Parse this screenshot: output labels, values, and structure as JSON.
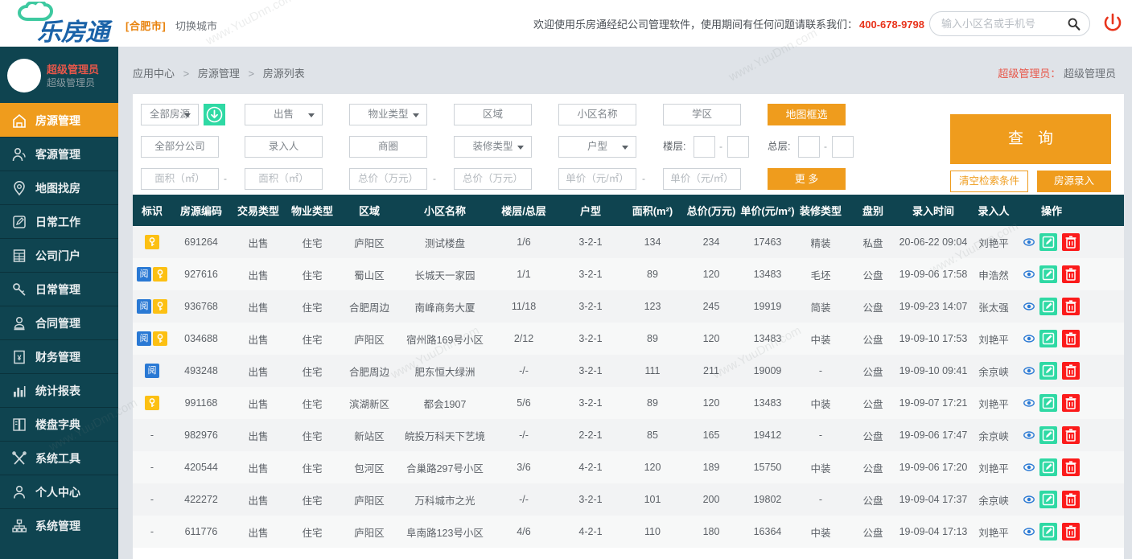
{
  "header": {
    "logo_text": "乐房通",
    "city_tag": "[合肥市]",
    "city_switch": "切换城市",
    "welcome": "欢迎使用乐房通经纪公司管理软件，使用期间有任何问题请联系我们：",
    "tel": "400-678-9798",
    "search_placeholder": "输入小区名或手机号",
    "search_value": "",
    "search_icon": "search-icon",
    "power_icon": "power-icon",
    "accent_orange": "#ef9c1d",
    "accent_red": "#e8341c"
  },
  "sidebar": {
    "user_name": "超级管理员",
    "user_role": "超级管理员",
    "bg_color": "#0f4450",
    "active_color": "#ef9c1d",
    "items": [
      {
        "label": "房源管理",
        "icon": "house-icon",
        "active": true
      },
      {
        "label": "客源管理",
        "icon": "users-icon",
        "active": false
      },
      {
        "label": "地图找房",
        "icon": "map-pin-icon",
        "active": false
      },
      {
        "label": "日常工作",
        "icon": "edit-box-icon",
        "active": false
      },
      {
        "label": "公司门户",
        "icon": "building-icon",
        "active": false
      },
      {
        "label": "日常管理",
        "icon": "key-icon",
        "active": false
      },
      {
        "label": "合同管理",
        "icon": "stamp-icon",
        "active": false
      },
      {
        "label": "财务管理",
        "icon": "yuan-icon",
        "active": false
      },
      {
        "label": "统计报表",
        "icon": "bar-chart-icon",
        "active": false
      },
      {
        "label": "楼盘字典",
        "icon": "book-icon",
        "active": false
      },
      {
        "label": "系统工具",
        "icon": "tools-icon",
        "active": false
      },
      {
        "label": "个人中心",
        "icon": "person-icon",
        "active": false
      },
      {
        "label": "系统管理",
        "icon": "sitemap-icon",
        "active": false
      }
    ]
  },
  "breadcrumb": {
    "items": [
      "应用中心",
      "房源管理",
      "房源列表"
    ],
    "separator": ">"
  },
  "topright_user": {
    "label": "超级管理员：",
    "value": "超级管理员"
  },
  "filters": {
    "source_select": "全部房源",
    "download_icon": "cloud-download-icon",
    "trade_type": "出售",
    "property_type": "物业类型",
    "region": "区域",
    "community": "小区名称",
    "school": "学区",
    "map_select_btn": "地图框选",
    "branch": "全部分公司",
    "inputter": "录入人",
    "business_circle": "商圈",
    "decoration": "装修类型",
    "house_type": "户型",
    "floor_label": "楼层:",
    "floor_min": "",
    "floor_max": "",
    "total_floor_label": "总层:",
    "total_floor_min": "",
    "total_floor_max": "",
    "area_min": "面积（㎡）",
    "area_max": "面积（㎡）",
    "total_price_min": "总价（万元）",
    "total_price_max": "总价（万元）",
    "unit_price_min": "单价（元/㎡）",
    "unit_price_max": "单价（元/㎡）",
    "more_btn": "更 多",
    "range_dash": "-",
    "query_btn": "查询",
    "clear_btn": "清空检索条件",
    "add_house_btn": "房源录入"
  },
  "table": {
    "columns": [
      "标识",
      "房源编码",
      "交易类型",
      "物业类型",
      "区域",
      "小区名称",
      "楼层/总层",
      "户型",
      "面积(m²)",
      "总价(万元)",
      "单价(元/m²)",
      "装修类型",
      "盘别",
      "录入时间",
      "录入人",
      "操作"
    ],
    "rows": [
      {
        "flags": [
          "key"
        ],
        "code": "691264",
        "trade": "出售",
        "ptype": "住宅",
        "region": "庐阳区",
        "community": "测试楼盘",
        "floor": "1/6",
        "layout": "3-2-1",
        "area": "134",
        "total": "234",
        "unit": "17463",
        "deco": "精装",
        "pan": "私盘",
        "time": "20-06-22 09:04",
        "user": "刘艳平"
      },
      {
        "flags": [
          "read",
          "key"
        ],
        "code": "927616",
        "trade": "出售",
        "ptype": "住宅",
        "region": "蜀山区",
        "community": "长城天一家园",
        "floor": "1/1",
        "layout": "3-2-1",
        "area": "89",
        "total": "120",
        "unit": "13483",
        "deco": "毛坯",
        "pan": "公盘",
        "time": "19-09-06 17:58",
        "user": "申浩然"
      },
      {
        "flags": [
          "read",
          "key"
        ],
        "code": "936768",
        "trade": "出售",
        "ptype": "住宅",
        "region": "合肥周边",
        "community": "南峰商务大厦",
        "floor": "11/18",
        "layout": "3-2-1",
        "area": "123",
        "total": "245",
        "unit": "19919",
        "deco": "简装",
        "pan": "公盘",
        "time": "19-09-23 14:07",
        "user": "张太强"
      },
      {
        "flags": [
          "read",
          "key"
        ],
        "code": "034688",
        "trade": "出售",
        "ptype": "住宅",
        "region": "庐阳区",
        "community": "宿州路169号小区",
        "floor": "2/12",
        "layout": "3-2-1",
        "area": "89",
        "total": "120",
        "unit": "13483",
        "deco": "中装",
        "pan": "公盘",
        "time": "19-09-10 17:53",
        "user": "刘艳平"
      },
      {
        "flags": [
          "read"
        ],
        "code": "493248",
        "trade": "出售",
        "ptype": "住宅",
        "region": "合肥周边",
        "community": "肥东恒大绿洲",
        "floor": "-/-",
        "layout": "3-2-1",
        "area": "111",
        "total": "211",
        "unit": "19009",
        "deco": "-",
        "pan": "公盘",
        "time": "19-09-10 09:41",
        "user": "余京峡"
      },
      {
        "flags": [
          "key"
        ],
        "code": "991168",
        "trade": "出售",
        "ptype": "住宅",
        "region": "滨湖新区",
        "community": "都会1907",
        "floor": "5/6",
        "layout": "3-2-1",
        "area": "89",
        "total": "120",
        "unit": "13483",
        "deco": "中装",
        "pan": "公盘",
        "time": "19-09-07 17:21",
        "user": "刘艳平"
      },
      {
        "flags": [],
        "code": "982976",
        "trade": "出售",
        "ptype": "住宅",
        "region": "新站区",
        "community": "皖投万科天下艺境",
        "floor": "-/-",
        "layout": "2-2-1",
        "area": "85",
        "total": "165",
        "unit": "19412",
        "deco": "-",
        "pan": "公盘",
        "time": "19-09-06 17:47",
        "user": "余京峡"
      },
      {
        "flags": [],
        "code": "420544",
        "trade": "出售",
        "ptype": "住宅",
        "region": "包河区",
        "community": "合巢路297号小区",
        "floor": "3/6",
        "layout": "4-2-1",
        "area": "120",
        "total": "189",
        "unit": "15750",
        "deco": "中装",
        "pan": "公盘",
        "time": "19-09-06 17:20",
        "user": "刘艳平"
      },
      {
        "flags": [],
        "code": "422272",
        "trade": "出售",
        "ptype": "住宅",
        "region": "庐阳区",
        "community": "万科城市之光",
        "floor": "-/-",
        "layout": "3-2-1",
        "area": "101",
        "total": "200",
        "unit": "19802",
        "deco": "-",
        "pan": "公盘",
        "time": "19-09-04 17:37",
        "user": "余京峡"
      },
      {
        "flags": [],
        "code": "611776",
        "trade": "出售",
        "ptype": "住宅",
        "region": "庐阳区",
        "community": "阜南路123号小区",
        "floor": "4/6",
        "layout": "4-2-1",
        "area": "110",
        "total": "180",
        "unit": "16364",
        "deco": "中装",
        "pan": "公盘",
        "time": "19-09-04 17:13",
        "user": "刘艳平"
      }
    ],
    "empty_flag": "-",
    "flag_labels": {
      "read": "阅",
      "key": "钥"
    },
    "ops": {
      "view_icon": "eye-icon",
      "edit_icon": "edit-icon",
      "delete_icon": "trash-icon"
    }
  },
  "watermarks": [
    "www.YuuDnn.com",
    "www.YuuDnn.com",
    "www.YuuDnn.com",
    "www.YuuDnn.com",
    "www.YuuDnn.com",
    "www.YuuDnn.com"
  ]
}
